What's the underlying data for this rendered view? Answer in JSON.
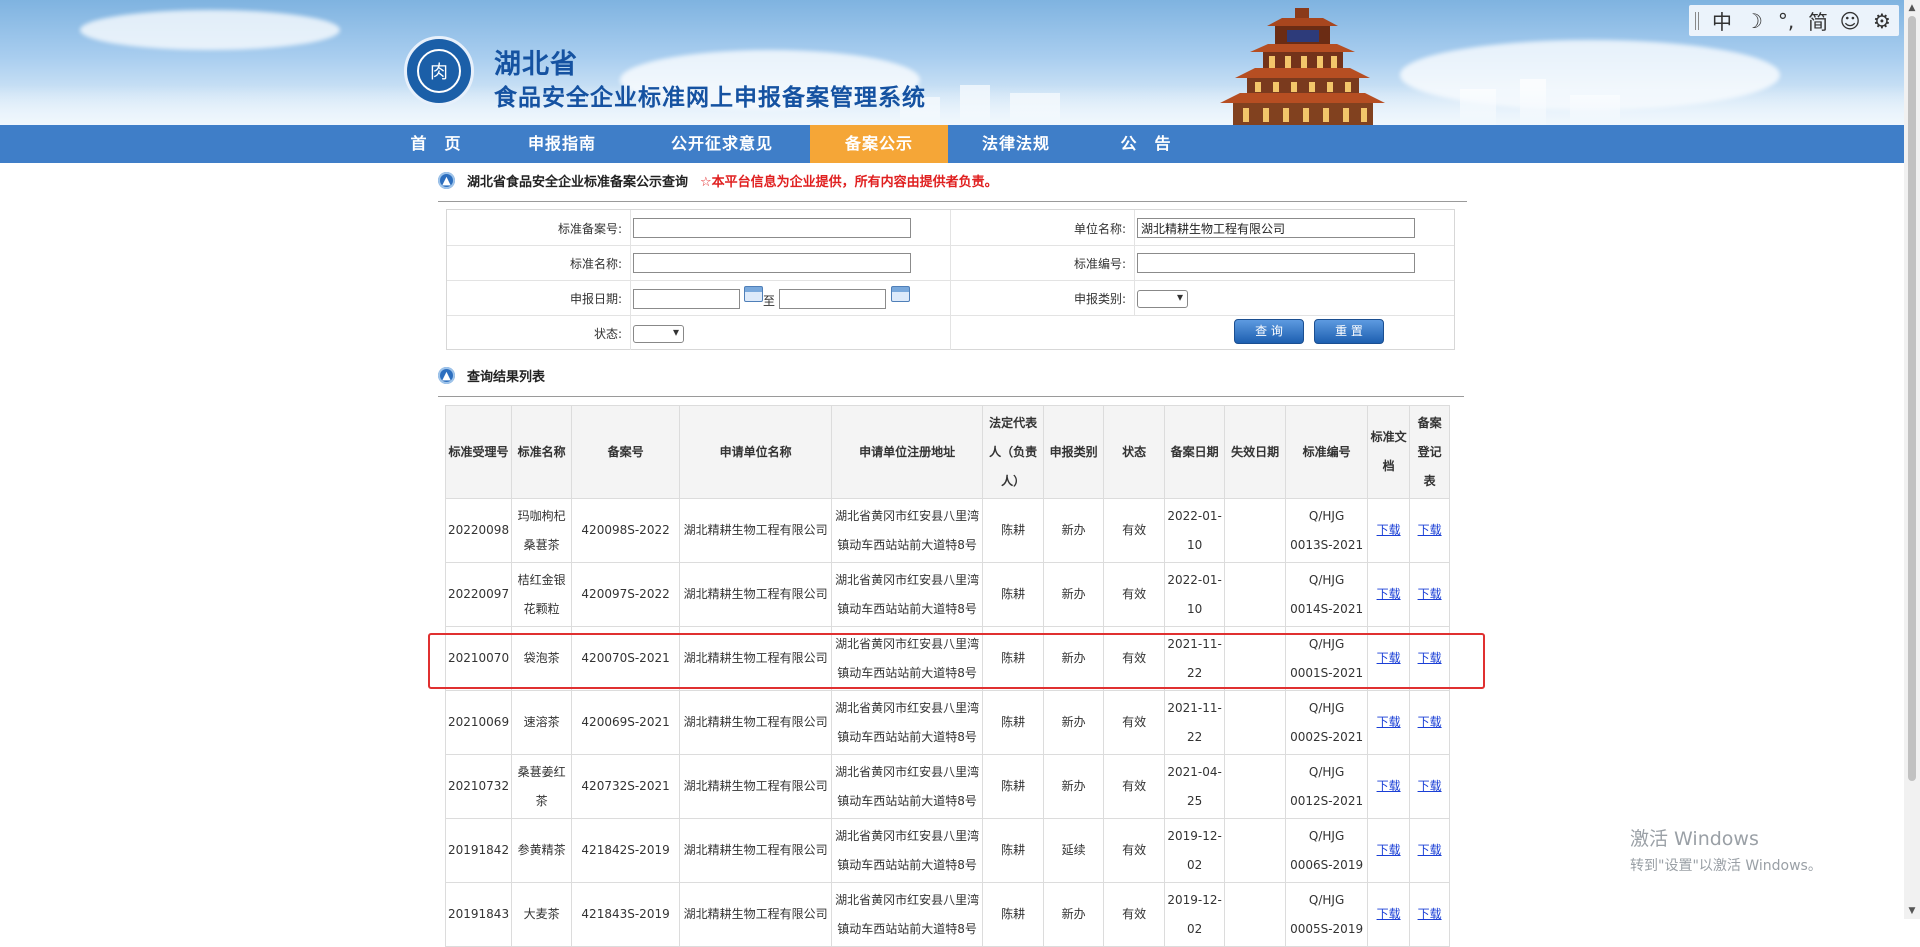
{
  "header": {
    "title_line1": "湖北省",
    "title_line2": "食品安全企业标准网上申报备案管理系统",
    "emblem_glyph": "肉",
    "toolbar": [
      "中",
      "☽",
      "°,",
      "简",
      "☺",
      "⚙"
    ]
  },
  "nav": {
    "items": [
      {
        "label": "首　页",
        "active": false
      },
      {
        "label": "申报指南",
        "active": false
      },
      {
        "label": "公开征求意见",
        "active": false
      },
      {
        "label": "备案公示",
        "active": true
      },
      {
        "label": "法律法规",
        "active": false
      },
      {
        "label": "公　告",
        "active": false
      }
    ],
    "active_color": "#f5a637",
    "bar_color": "#3f7ec8"
  },
  "search_section": {
    "title": "湖北省食品安全企业标准备案公示查询",
    "notice": "☆本平台信息为企业提供，所有内容由提供者负责。"
  },
  "form": {
    "record_no_label": "标准备案号:",
    "record_no_value": "",
    "unit_name_label": "单位名称:",
    "unit_name_value": "湖北精耕生物工程有限公司",
    "std_name_label": "标准名称:",
    "std_name_value": "",
    "std_code_label": "标准编号:",
    "std_code_value": "",
    "date_label": "申报日期:",
    "date_from": "",
    "date_to_label": "至",
    "date_to": "",
    "type_label": "申报类别:",
    "type_value": "",
    "status_label": "状态:",
    "status_value": "",
    "query_button": "查 询",
    "reset_button": "重 置"
  },
  "results_section": {
    "title": "查询结果列表"
  },
  "table": {
    "columns": [
      "标准受理号",
      "标准名称",
      "备案号",
      "申请单位名称",
      "申请单位注册地址",
      "法定代表人（负责人）",
      "申报类别",
      "状态",
      "备案日期",
      "失效日期",
      "标准编号",
      "标准文档",
      "备案登记表"
    ],
    "rows": [
      {
        "accept_no": "20220098",
        "name": "玛咖枸杞桑葚茶",
        "record_no": "420098S-2022",
        "unit": "湖北精耕生物工程有限公司",
        "address": "湖北省黄冈市红安县八里湾镇动车西站站前大道特8号",
        "legal": "陈耕",
        "type": "新办",
        "status": "有效",
        "record_date": "2022-01-10",
        "expire": "",
        "std_no": "Q/HJG 0013S-2021",
        "doc": "下载",
        "form": "下载"
      },
      {
        "accept_no": "20220097",
        "name": "桔红金银花颗粒",
        "record_no": "420097S-2022",
        "unit": "湖北精耕生物工程有限公司",
        "address": "湖北省黄冈市红安县八里湾镇动车西站站前大道特8号",
        "legal": "陈耕",
        "type": "新办",
        "status": "有效",
        "record_date": "2022-01-10",
        "expire": "",
        "std_no": "Q/HJG 0014S-2021",
        "doc": "下载",
        "form": "下载"
      },
      {
        "accept_no": "20210070",
        "name": "袋泡茶",
        "record_no": "420070S-2021",
        "unit": "湖北精耕生物工程有限公司",
        "address": "湖北省黄冈市红安县八里湾镇动车西站站前大道特8号",
        "legal": "陈耕",
        "type": "新办",
        "status": "有效",
        "record_date": "2021-11-22",
        "expire": "",
        "std_no": "Q/HJG 0001S-2021",
        "doc": "下载",
        "form": "下载"
      },
      {
        "accept_no": "20210069",
        "name": "速溶茶",
        "record_no": "420069S-2021",
        "unit": "湖北精耕生物工程有限公司",
        "address": "湖北省黄冈市红安县八里湾镇动车西站站前大道特8号",
        "legal": "陈耕",
        "type": "新办",
        "status": "有效",
        "record_date": "2021-11-22",
        "expire": "",
        "std_no": "Q/HJG 0002S-2021",
        "doc": "下载",
        "form": "下载"
      },
      {
        "accept_no": "20210732",
        "name": "桑葚姜红茶",
        "record_no": "420732S-2021",
        "unit": "湖北精耕生物工程有限公司",
        "address": "湖北省黄冈市红安县八里湾镇动车西站站前大道特8号",
        "legal": "陈耕",
        "type": "新办",
        "status": "有效",
        "record_date": "2021-04-25",
        "expire": "",
        "std_no": "Q/HJG 0012S-2021",
        "doc": "下载",
        "form": "下载"
      },
      {
        "accept_no": "20191842",
        "name": "参黄精茶",
        "record_no": "421842S-2019",
        "unit": "湖北精耕生物工程有限公司",
        "address": "湖北省黄冈市红安县八里湾镇动车西站站前大道特8号",
        "legal": "陈耕",
        "type": "延续",
        "status": "有效",
        "record_date": "2019-12-02",
        "expire": "",
        "std_no": "Q/HJG 0006S-2019",
        "doc": "下载",
        "form": "下载"
      },
      {
        "accept_no": "20191843",
        "name": "大麦茶",
        "record_no": "421843S-2019",
        "unit": "湖北精耕生物工程有限公司",
        "address": "湖北省黄冈市红安县八里湾镇动车西站站前大道特8号",
        "legal": "陈耕",
        "type": "新办",
        "status": "有效",
        "record_date": "2019-12-02",
        "expire": "",
        "std_no": "Q/HJG 0005S-2019",
        "doc": "下载",
        "form": "下载"
      }
    ]
  },
  "watermark": {
    "line1": "激活 Windows",
    "line2": "转到\"设置\"以激活 Windows。"
  }
}
